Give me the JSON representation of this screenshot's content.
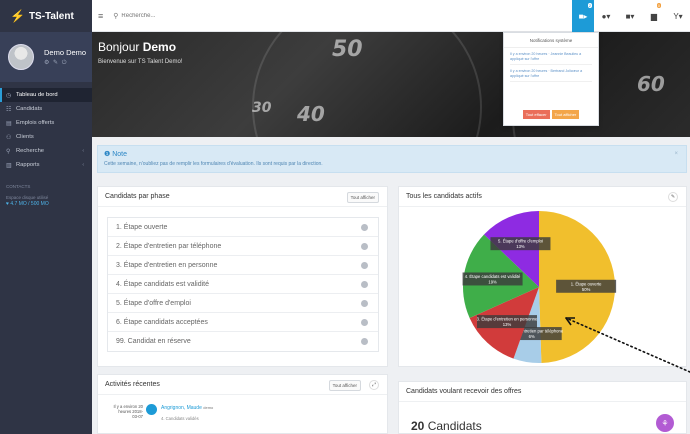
{
  "sidebar": {
    "brand": "TS-Talent",
    "user_name": "Demo Demo",
    "items": [
      {
        "label": "Tableau de bord",
        "icon": "dashboard-icon",
        "active": true
      },
      {
        "label": "Candidats",
        "icon": "users-icon"
      },
      {
        "label": "Emplois offerts",
        "icon": "briefcase-icon"
      },
      {
        "label": "Clients",
        "icon": "user-icon"
      },
      {
        "label": "Recherche",
        "icon": "search-icon",
        "chevron": true
      },
      {
        "label": "Rapports",
        "icon": "chart-icon",
        "chevron": true
      }
    ],
    "section_label": "CONTACTS",
    "quota_label": "Espace disque utilisé",
    "quota_value": "♥ 4.7 MO / 500 MO"
  },
  "topbar": {
    "search_placeholder": "Recherche...",
    "cam_badge": "2",
    "files_badge": "0"
  },
  "hero": {
    "greeting": "Bonjour",
    "name": "Demo",
    "subtitle": "Bienvenue sur TS Talent Demo!",
    "dial_numbers": [
      "50",
      "40",
      "30",
      "60"
    ]
  },
  "notifications": {
    "title": "Notifications système",
    "items": [
      "Il y a environ 20 heures · Jeannie Beaulieu a appliqué sur l'offre",
      "Il y a environ 20 heures · Bertrand Jolicœur a appliqué sur l'offre"
    ],
    "clear_label": "Tout effacer",
    "show_label": "Tout afficher"
  },
  "note": {
    "title": "Note",
    "text": "Cette semaine, n'oubliez pas de remplir les formulaires d'évaluation. Ils sont requis par la direction."
  },
  "phases_panel": {
    "title": "Candidats par phase",
    "button": "Tout afficher",
    "rows": [
      {
        "label": "1. Étape ouverte"
      },
      {
        "label": "2. Étape d'entretien par téléphone"
      },
      {
        "label": "3. Étape d'entretien en personne"
      },
      {
        "label": "4. Étape candidats est validité"
      },
      {
        "label": "5. Étape d'offre d'emploi"
      },
      {
        "label": "6. Étape candidats acceptées"
      },
      {
        "label": "99. Candidat en réserve"
      }
    ]
  },
  "activity_panel": {
    "title": "Activités récentes",
    "button": "Tout afficher",
    "time": "Il y a environ 20 heures 2018-03-07",
    "name": "Angrignon, Maude",
    "tag": "demo",
    "desc": "4. Candidats validés"
  },
  "pie_panel": {
    "title": "Tous les candidats actifs",
    "slices": [
      {
        "label": "1. Étape ouverte",
        "pct": "50%",
        "value": 50,
        "color": "#f1bf2d"
      },
      {
        "label": "2. Étape d'entretien par téléphone",
        "pct": "6%",
        "value": 6,
        "color": "#a8cde8"
      },
      {
        "label": "3. Étape d'entretien en personne",
        "pct": "13%",
        "value": 13,
        "color": "#d13b3b"
      },
      {
        "label": "4. Étape candidats est validité",
        "pct": "19%",
        "value": 19,
        "color": "#3fae49"
      },
      {
        "label": "5. Étape d'offre d'emploi",
        "pct": "13%",
        "value": 13,
        "color": "#8e2be2"
      }
    ]
  },
  "offers_panel": {
    "title": "Candidats voulant recevoir des offres",
    "count": "20",
    "count_label": "Candidats"
  }
}
